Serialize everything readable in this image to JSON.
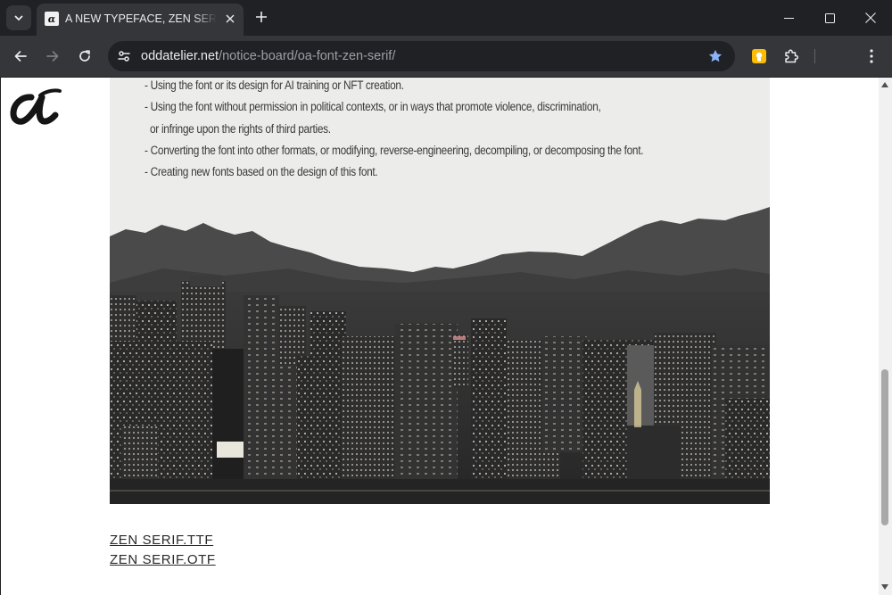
{
  "browser": {
    "tab": {
      "title": "A NEW TYPEFACE, ZEN SERIF - ODD ATELIER",
      "favicon_letter": "α"
    },
    "address_bar": {
      "host": "oddatelier.net",
      "path": "/notice-board/oa-font-zen-serif/"
    },
    "accent_star_color": "#8ab4f8",
    "extension_color": "#fbbc04"
  },
  "page": {
    "logo_text": "α",
    "restrictions": [
      "- Using the font or its design for AI training or NFT creation.",
      "- Using the font without permission in political contexts, or in ways that promote violence, discrimination,",
      "or infringe upon the rights of third parties.",
      "- Converting the font into other formats, or modifying, reverse-engineering, decompiling, or decomposing the font.",
      "- Creating new fonts based on the design of this font."
    ],
    "hero_image": {
      "alt": "night-city-skyline-with-mountains"
    },
    "downloads": [
      "ZEN SERIF.TTF",
      "ZEN SERIF.OTF"
    ]
  }
}
